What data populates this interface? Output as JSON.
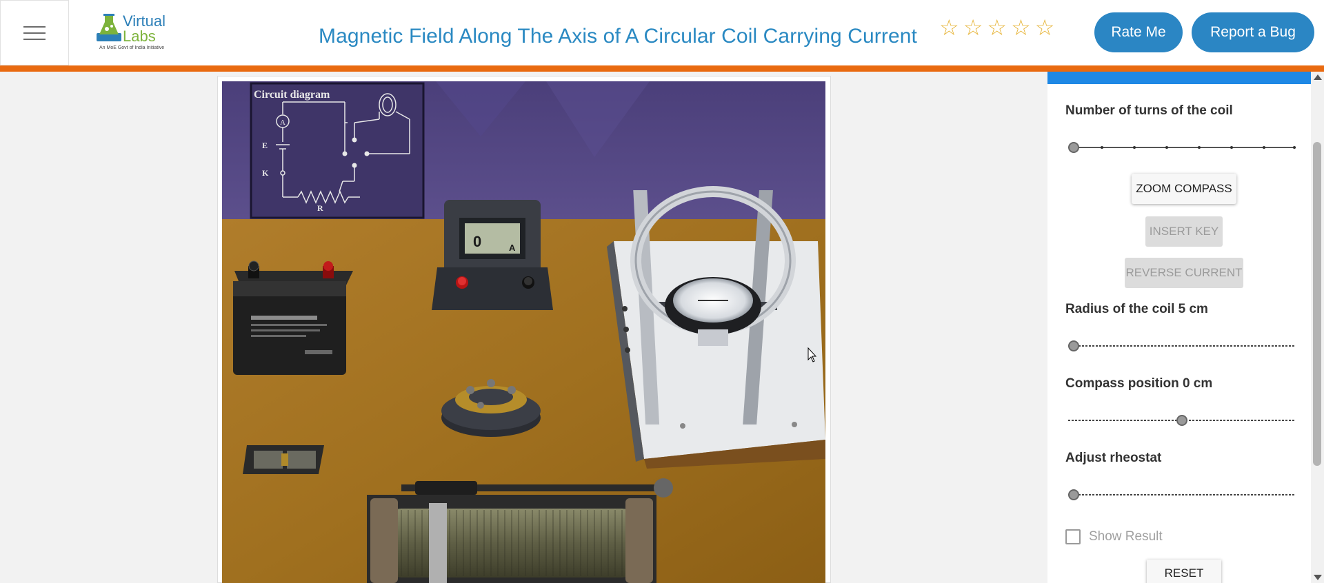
{
  "header": {
    "title": "Magnetic Field Along The Axis of A Circular Coil Carrying Current",
    "logo_word_1": "Virtual",
    "logo_word_2": "Labs",
    "logo_tagline": "An MoE Govt of India Initiative",
    "stars": [
      "☆",
      "☆",
      "☆",
      "☆",
      "☆"
    ],
    "rate_button": "Rate Me",
    "bug_button": "Report a Bug"
  },
  "simulation": {
    "circuit_title": "Circuit diagram",
    "circuit_labels": {
      "ammeter": "A",
      "battery": "E",
      "key": "K",
      "rheostat": "R"
    },
    "ammeter_value": "0",
    "ammeter_unit": "A"
  },
  "controls": {
    "turns_label": "Number of turns of the coil",
    "turns_value": 0,
    "zoom_compass": "ZOOM COMPASS",
    "insert_key": "INSERT KEY",
    "reverse_current": "REVERSE CURRENT",
    "radius_label": "Radius of the coil 5 cm",
    "radius_value": 0,
    "compass_label": "Compass position 0 cm",
    "compass_value": 0.5,
    "rheostat_label": "Adjust rheostat",
    "rheostat_value": 0,
    "show_result": "Show Result",
    "show_result_checked": false,
    "reset": "RESET"
  },
  "colors": {
    "accent": "#2b86c4",
    "orange": "#e96a10",
    "panel_bar": "#1e88e5",
    "stars": "#e7b53a"
  }
}
